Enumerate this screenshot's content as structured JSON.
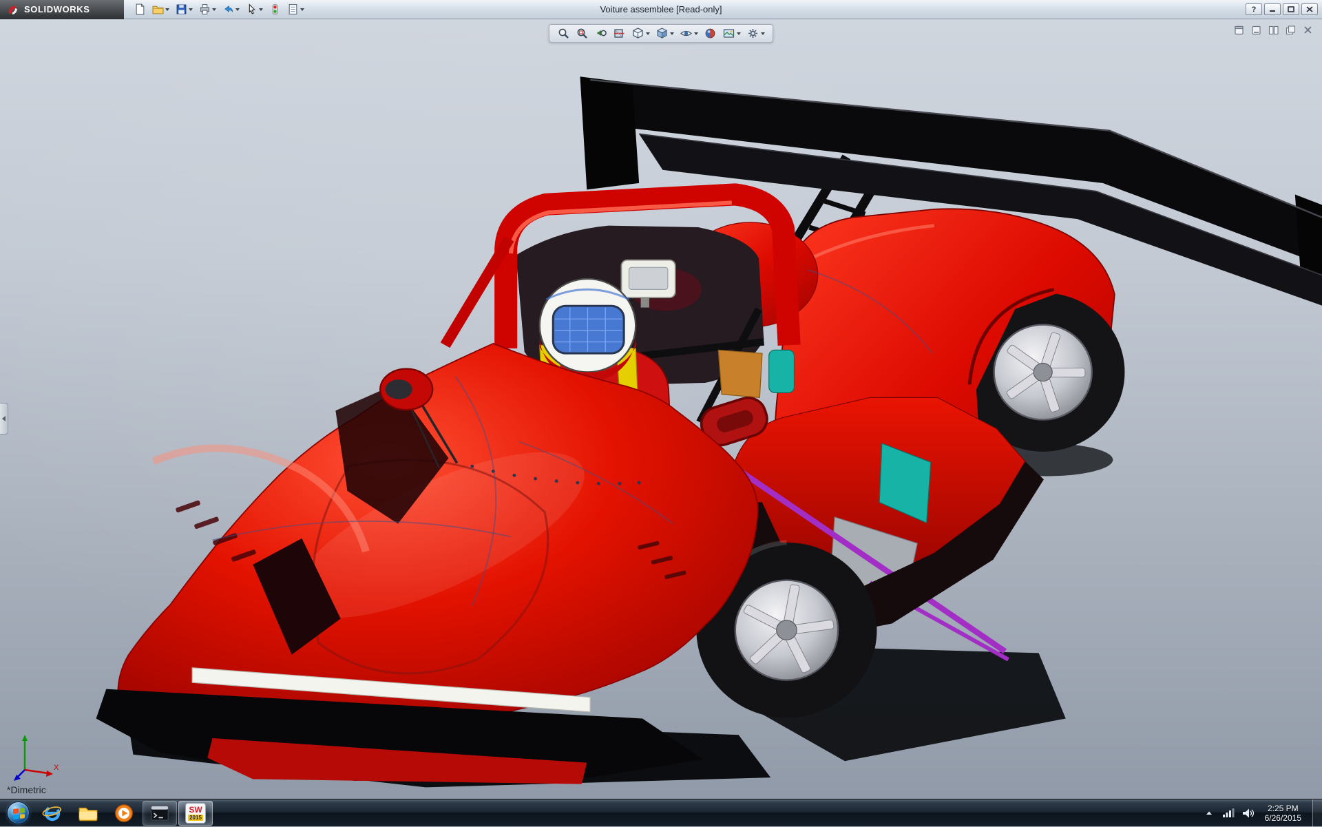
{
  "window": {
    "brand": "SOLIDWORKS",
    "title": "Voiture assemblee [Read-only]",
    "help_label": "?",
    "control_icons": [
      "minimize",
      "maximize",
      "close"
    ]
  },
  "main_toolbar": {
    "icons": [
      "new-document",
      "open",
      "save",
      "print",
      "undo",
      "select",
      "rebuild",
      "options"
    ]
  },
  "heads_up_toolbar": {
    "icons": [
      "zoom-to-fit",
      "zoom-to-area",
      "previous-view",
      "section-view",
      "view-orientation",
      "display-style",
      "hide-show-items",
      "edit-appearance",
      "apply-scene",
      "view-settings"
    ]
  },
  "document_window_controls": {
    "icons": [
      "restore-window",
      "minimize-window",
      "tile-windows",
      "cascade-windows",
      "close-window"
    ]
  },
  "viewport": {
    "view_orientation_label": "*Dimetric",
    "triad_axis_label": "X",
    "background_top": "#d0d6de",
    "background_bottom": "#919aa8"
  },
  "model": {
    "subject": "red prototype race car assembly with driver",
    "body_red": "#d40b00",
    "wing_black": "#0b0b0d",
    "accent_teal": "#17b3a6",
    "accent_purple": "#a22ec6",
    "accent_orange": "#c8802a",
    "harness_yellow": "#e6cf00",
    "visor_blue": "#3a6fd0",
    "wheel_silver": "#c9c9d0",
    "splitter_stripe_white": "#f4f4ef"
  },
  "taskbar": {
    "icons": [
      "start",
      "internet-explorer",
      "windows-explorer",
      "media-player",
      "command-prompt",
      "solidworks-2015"
    ],
    "solidworks": {
      "initials": "SW",
      "badge": "2015"
    },
    "tray": {
      "icons": [
        "show-hidden",
        "network",
        "volume"
      ],
      "time": "2:25 PM",
      "date": "6/26/2015"
    }
  }
}
